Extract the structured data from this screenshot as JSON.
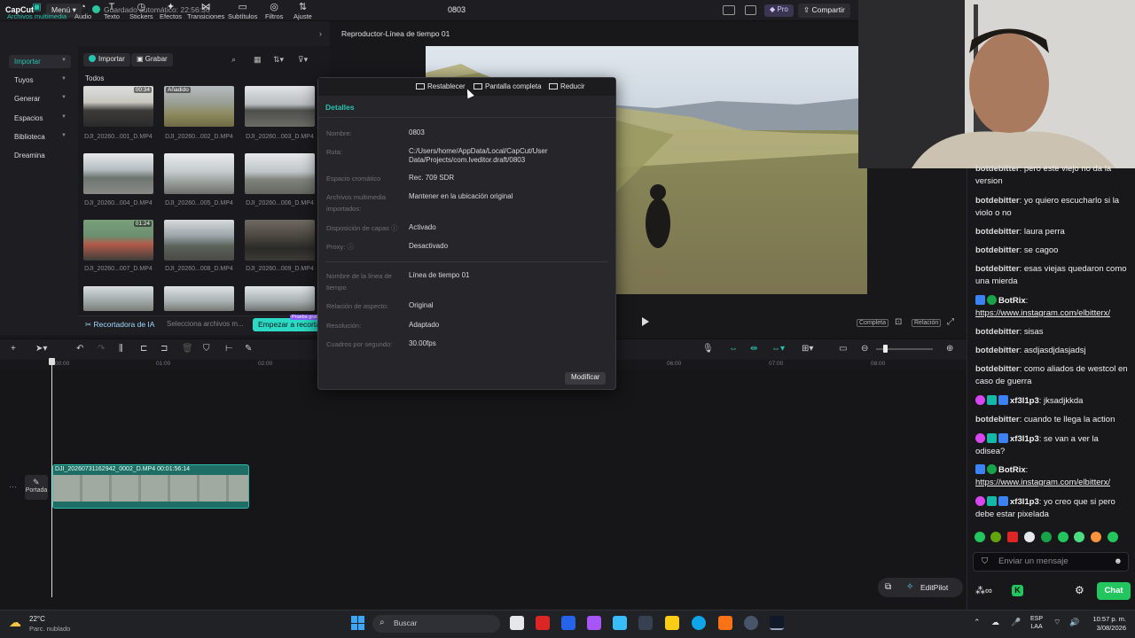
{
  "app": {
    "logo": "CapCut",
    "menu_label": "Menú",
    "autosave": "Guardado automático: 22:56:36",
    "project_title": "0803",
    "pro_label": "Pro",
    "share_label": "Compartir"
  },
  "toolbar": {
    "items": [
      "Archivos multimedia",
      "Audio",
      "Texto",
      "Stickers",
      "Efectos",
      "Transiciones",
      "Subtítulos",
      "Filtros",
      "Ajuste"
    ],
    "icons": [
      "media-icon",
      "audio-icon",
      "text-icon",
      "sticker-icon",
      "effects-icon",
      "transitions-icon",
      "subtitles-icon",
      "filters-icon",
      "adjust-icon"
    ]
  },
  "sidebar": {
    "items": [
      "Importar",
      "Tuyos",
      "Generar",
      "Espacios",
      "Biblioteca",
      "Dreamina"
    ]
  },
  "media": {
    "import_label": "Importar",
    "record_label": "Grabar",
    "all_label": "Todos",
    "thumbs": [
      {
        "name": "DJI_20260...001_D.MP4",
        "badge": "00:34"
      },
      {
        "name": "DJI_20260...002_D.MP4",
        "badge": "Añadido"
      },
      {
        "name": "DJI_20260...003_D.MP4",
        "badge": ""
      },
      {
        "name": "DJI_20260...004_D.MP4",
        "badge": ""
      },
      {
        "name": "DJI_20260...005_D.MP4",
        "badge": ""
      },
      {
        "name": "DJI_20260...006_D.MP4",
        "badge": ""
      },
      {
        "name": "DJI_20260...007_D.MP4",
        "badge": "01:24"
      },
      {
        "name": "DJI_20260...008_D.MP4",
        "badge": ""
      },
      {
        "name": "DJI_20260...009_D.MP4",
        "badge": ""
      },
      {
        "name": "",
        "badge": ""
      },
      {
        "name": "",
        "badge": ""
      },
      {
        "name": "",
        "badge": ""
      }
    ],
    "ai_title": "Recortadora de IA",
    "ai_sub": "Selecciona archivos m...",
    "ai_start": "Empezar a recortar",
    "ai_tag": "Prueba gratis"
  },
  "player": {
    "title": "Reproductor-Línea de tiempo 01",
    "complete_label": "Completa",
    "ratio_label": "Relación"
  },
  "dialog": {
    "btn_reset": "Restablecer",
    "btn_fullscreen": "Pantalla completa",
    "btn_reduce": "Reducir",
    "tab": "Detalles",
    "fields": [
      {
        "label": "Nombre:",
        "value": "0803"
      },
      {
        "label": "Ruta:",
        "value": "C:/Users/home/AppData/Local/CapCut/User Data/Projects/com.lveditor.draft/0803"
      },
      {
        "label": "Espacio cromático",
        "value": "Rec. 709 SDR"
      },
      {
        "label": "Archivos multimedia importados:",
        "value": "Mantener en la ubicación original"
      },
      {
        "label": "Disposición de capas",
        "value": "Activado"
      },
      {
        "label": "Proxy:",
        "value": "Desactivado"
      },
      {
        "label": "Nombre de la línea de tiempo",
        "value": "Línea de tiempo 01"
      },
      {
        "label": "Relación de aspecto:",
        "value": "Original"
      },
      {
        "label": "Resolución:",
        "value": "Adaptado"
      },
      {
        "label": "Cuadros por segundo:",
        "value": "30.00fps"
      }
    ],
    "modify": "Modificar"
  },
  "timeline": {
    "ticks": [
      "00:00",
      "01:00",
      "02:00",
      "06:00",
      "07:00",
      "08:00"
    ],
    "clip_label": "DJI_20260731162942_0002_D.MP4   00:01:56:14",
    "cover_label": "Portada",
    "editpilot": "EditPilot"
  },
  "chat": {
    "messages": [
      {
        "user": "botdebitter",
        "text": "pero este viejo no da la version"
      },
      {
        "user": "botdebitter",
        "text": "yo quiero escucharlo si la violo o no"
      },
      {
        "user": "botdebitter",
        "text": "laura perra"
      },
      {
        "user": "botdebitter",
        "text": "se cagoo"
      },
      {
        "user": "botdebitter",
        "text": "esas viejas quedaron como una mierda"
      },
      {
        "user": "BotRix",
        "text": "https://www.instagram.com/elbitterx/"
      },
      {
        "user": "botdebitter",
        "text": "sisas"
      },
      {
        "user": "botdebitter",
        "text": "asdjasdjdasjadsj"
      },
      {
        "user": "botdebitter",
        "text": "como aliados de westcol en caso de guerra"
      },
      {
        "user": "xf3l1p3",
        "text": "jksadjkkda"
      },
      {
        "user": "botdebitter",
        "text": "cuando te llega la action"
      },
      {
        "user": "xf3l1p3",
        "text": "se van a ver la odisea?"
      },
      {
        "user": "BotRix",
        "text": "https://www.instagram.com/elbitterx/"
      },
      {
        "user": "xf3l1p3",
        "text": "yo creo que si pero debe estar pixelada"
      }
    ],
    "input_placeholder": "Enviar un mensaje",
    "chat_button": "Chat"
  },
  "taskbar": {
    "temp": "22°C",
    "weather": "Parc. nublado",
    "search": "Buscar",
    "lang1": "ESP",
    "lang2": "LAA",
    "time": "10:57 p. m.",
    "date": "3/08/2026"
  }
}
